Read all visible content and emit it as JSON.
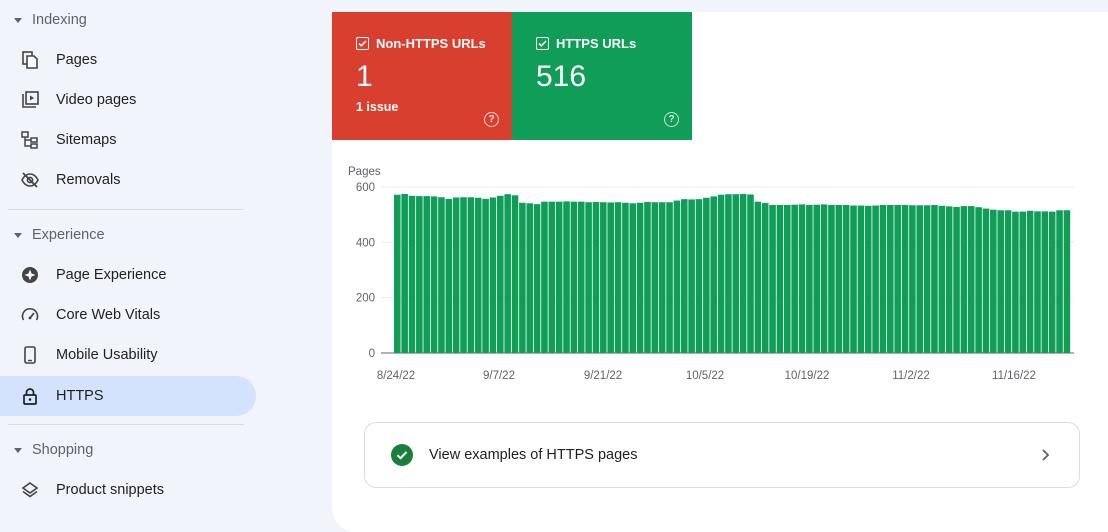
{
  "sidebar": {
    "sections": [
      {
        "title": "Indexing",
        "items": [
          {
            "label": "Pages",
            "icon": "pages-icon"
          },
          {
            "label": "Video pages",
            "icon": "video-pages-icon"
          },
          {
            "label": "Sitemaps",
            "icon": "sitemaps-icon"
          },
          {
            "label": "Removals",
            "icon": "removals-icon"
          }
        ]
      },
      {
        "title": "Experience",
        "items": [
          {
            "label": "Page Experience",
            "icon": "page-experience-icon"
          },
          {
            "label": "Core Web Vitals",
            "icon": "speedometer-icon"
          },
          {
            "label": "Mobile Usability",
            "icon": "phone-icon"
          },
          {
            "label": "HTTPS",
            "icon": "lock-icon",
            "active": true
          }
        ]
      },
      {
        "title": "Shopping",
        "items": [
          {
            "label": "Product snippets",
            "icon": "layers-icon"
          }
        ]
      }
    ]
  },
  "metrics": [
    {
      "label": "Non-HTTPS URLs",
      "value": "1",
      "sub": "1 issue",
      "color": "#d93f2f",
      "checked": true
    },
    {
      "label": "HTTPS URLs",
      "value": "516",
      "sub": "",
      "color": "#0f9d58",
      "checked": true
    }
  ],
  "chart_data": {
    "type": "bar",
    "ylabel": "Pages",
    "ylim": [
      0,
      600
    ],
    "yticks": [
      "0",
      "200",
      "400",
      "600"
    ],
    "xtick_labels": [
      "8/24/22",
      "9/7/22",
      "9/21/22",
      "10/5/22",
      "10/19/22",
      "11/2/22",
      "11/16/22"
    ],
    "bar_color": "#0f9d58",
    "grid": true,
    "series": [
      {
        "values": [
          572,
          575,
          568,
          567,
          567,
          566,
          563,
          557,
          562,
          563,
          563,
          561,
          557,
          562,
          568,
          574,
          570,
          543,
          541,
          538,
          547,
          547,
          547,
          548,
          547,
          547,
          545,
          546,
          545,
          544,
          545,
          543,
          541,
          543,
          546,
          545,
          545,
          545,
          551,
          556,
          555,
          556,
          561,
          566,
          572,
          574,
          574,
          575,
          573,
          547,
          542,
          535,
          535,
          535,
          536,
          537,
          535,
          536,
          537,
          535,
          535,
          535,
          533,
          533,
          532,
          533,
          535,
          535,
          535,
          535,
          534,
          534,
          534,
          535,
          532,
          530,
          528,
          531,
          531,
          527,
          522,
          518,
          516,
          516,
          511,
          511,
          514,
          512,
          512,
          511,
          516,
          516
        ]
      }
    ]
  },
  "examples_link": {
    "label": "View examples of HTTPS pages"
  }
}
